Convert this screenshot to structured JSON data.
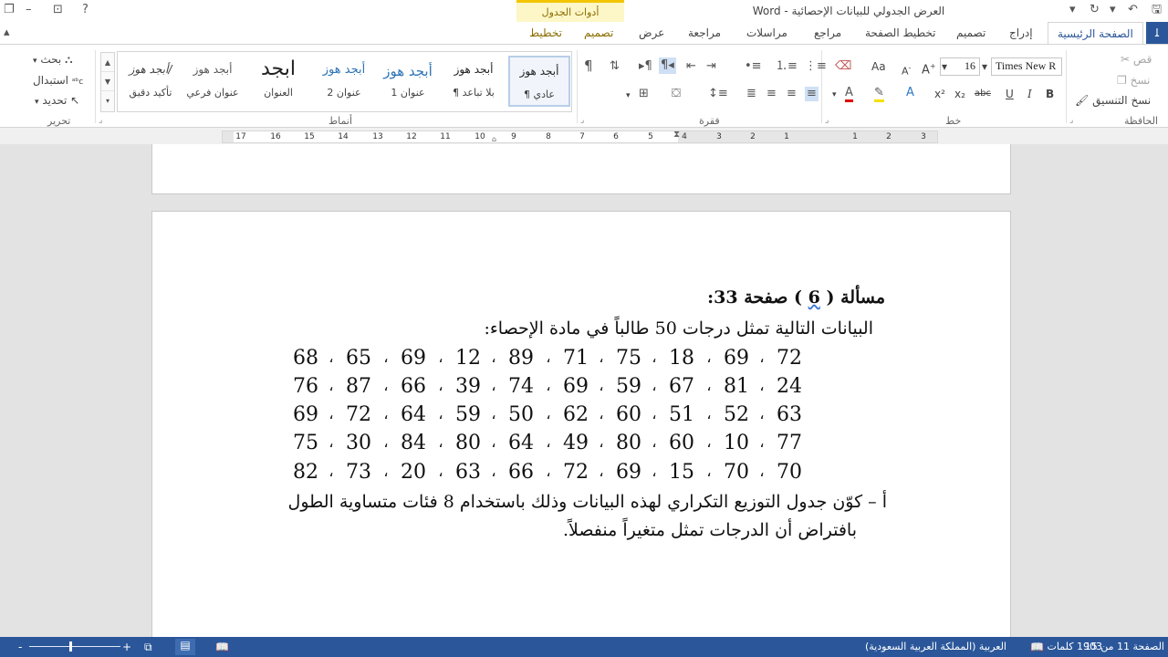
{
  "window": {
    "title": "العرض الجدولي للبيانات الإحصائية - Word",
    "context_group": "أدوات الجدول"
  },
  "tabs": {
    "file": "ﻠ",
    "home": "الصفحة الرئيسية",
    "insert": "إدراج",
    "design": "تصميم",
    "layout": "تخطيط الصفحة",
    "references": "مراجع",
    "mailings": "مراسلات",
    "review": "مراجعة",
    "view": "عرض",
    "table_design": "تصميم",
    "table_layout": "تخطيط"
  },
  "clipboard": {
    "label": "الحافظة",
    "cut": "قص",
    "copy": "نسخ",
    "format_painter": "نسخ التنسيق"
  },
  "font": {
    "label": "خط",
    "name": "Times New R",
    "size": "16",
    "bold": "B",
    "italic": "I",
    "underline": "U",
    "strike": "abc",
    "subscript": "x₂",
    "superscript": "x²",
    "grow": "A",
    "shrink": "A",
    "case": "Aa"
  },
  "paragraph": {
    "label": "فقرة",
    "pilcrow": "¶"
  },
  "styles": {
    "label": "أنماط",
    "items": [
      {
        "sample": "أبجد هوز",
        "name": "¶ عادي"
      },
      {
        "sample": "أبجد هوز",
        "name": "¶ بلا تباعد"
      },
      {
        "sample": "أبجد هوز",
        "name": "عنوان 1"
      },
      {
        "sample": "أبجد هوز",
        "name": "عنوان 2"
      },
      {
        "sample": "ابجد",
        "name": "العنوان"
      },
      {
        "sample": "أبجد هوز",
        "name": "عنوان فرعي"
      },
      {
        "sample": "أبجد هوز/",
        "name": "تأكيد دقيق"
      }
    ]
  },
  "editing": {
    "label": "تحرير",
    "find": "بحث",
    "replace": "استبدال",
    "select": "تحديد"
  },
  "ruler": {
    "numbers": [
      "17",
      "16",
      "15",
      "14",
      "13",
      "12",
      "11",
      "10",
      "9",
      "8",
      "7",
      "6",
      "5",
      "4",
      "3",
      "2",
      "1",
      "1",
      "2",
      "3"
    ]
  },
  "document": {
    "heading_prefix": "مسألة (",
    "heading_number": "6",
    "heading_suffix": ") صفحة 33:",
    "intro": "البيانات التالية تمثل درجات 50 طالباً في مادة الإحصاء:",
    "separator": "،",
    "rows": [
      [
        "72",
        "69",
        "18",
        "75",
        "71",
        "89",
        "12",
        "69",
        "65",
        "68"
      ],
      [
        "24",
        "81",
        "67",
        "59",
        "69",
        "74",
        "39",
        "66",
        "87",
        "76"
      ],
      [
        "63",
        "52",
        "51",
        "60",
        "62",
        "50",
        "59",
        "64",
        "72",
        "69"
      ],
      [
        "77",
        "10",
        "60",
        "80",
        "49",
        "64",
        "80",
        "84",
        "30",
        "75"
      ],
      [
        "70",
        "70",
        "15",
        "69",
        "72",
        "66",
        "63",
        "20",
        "73",
        "82"
      ]
    ],
    "question_line1": "أ – كوّن جدول التوزيع التكراري لهذه البيانات وذلك باستخدام 8 فئات متساوية الطول",
    "question_line2": "بافتراض أن الدرجات تمثل متغيراً منفصلاً."
  },
  "status": {
    "page": "الصفحة 11 من 15",
    "words": "1903 كلمات",
    "language": "العربية (المملكة العربية السعودية)",
    "zoom_plus": "+",
    "zoom_minus": "-"
  },
  "colors": {
    "accent": "#2b579a",
    "context": "#f3c500"
  }
}
